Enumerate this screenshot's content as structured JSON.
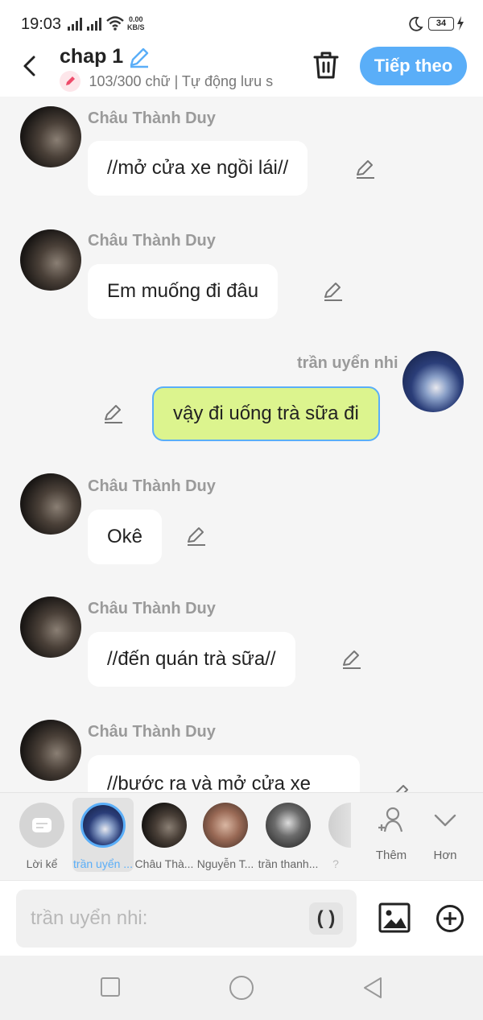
{
  "status_bar": {
    "time": "19:03",
    "net_speed_value": "0.00",
    "net_speed_unit": "KB/S",
    "battery": "34"
  },
  "header": {
    "title": "chap 1",
    "word_count": "103/300 chữ | Tự động lưu s",
    "next_button": "Tiếp theo",
    "accent_color": "#5aaef8"
  },
  "messages": [
    {
      "sender": "Châu Thành Duy",
      "text": "//mở cửa xe ngồi lái//",
      "side": "left"
    },
    {
      "sender": "Châu Thành Duy",
      "text": "Em muống đi đâu",
      "side": "left"
    },
    {
      "sender": "trần uyển nhi",
      "text": "vậy đi uống trà sữa đi",
      "side": "right"
    },
    {
      "sender": "Châu Thành Duy",
      "text": "Okê",
      "side": "left"
    },
    {
      "sender": "Châu Thành Duy",
      "text": "//đến quán trà sữa//",
      "side": "left"
    },
    {
      "sender": "Châu Thành Duy",
      "text": "//bước ra và mở cửa xe",
      "side": "left"
    }
  ],
  "characters": [
    {
      "label": "Lời kể"
    },
    {
      "label": "trần uyển ..."
    },
    {
      "label": "Châu Thà..."
    },
    {
      "label": "Nguyễn T..."
    },
    {
      "label": "trần thanh..."
    },
    {
      "label": "?"
    }
  ],
  "strip_actions": {
    "add_label": "Thêm",
    "more_label": "Hơn"
  },
  "input": {
    "placeholder": "trần uyển nhi:",
    "paren_label": "( )"
  }
}
